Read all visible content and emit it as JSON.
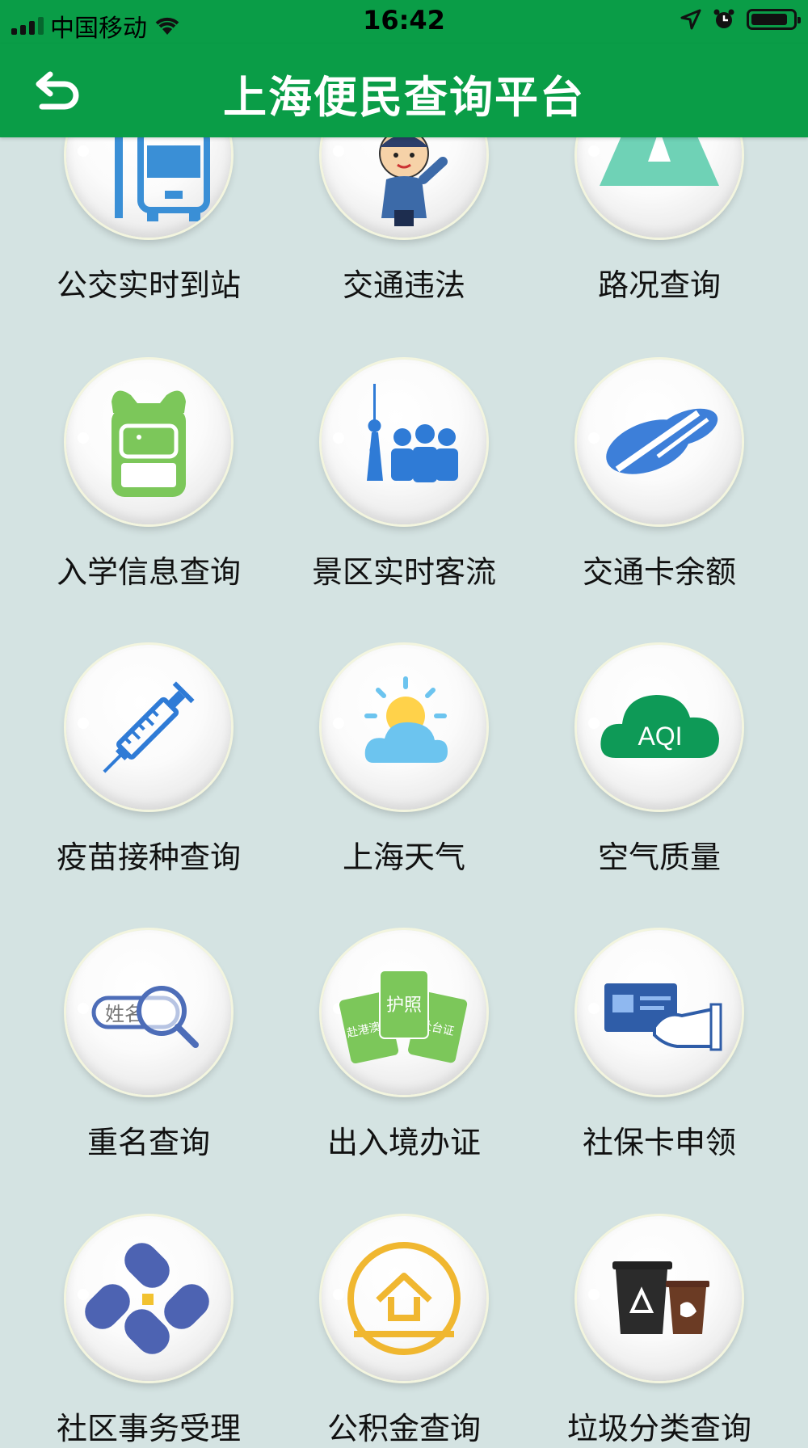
{
  "status_bar": {
    "carrier": "中国移动",
    "time": "16:42"
  },
  "header": {
    "title": "上海便民查询平台"
  },
  "services": [
    {
      "label": "公交实时到站",
      "icon": "bus-icon"
    },
    {
      "label": "交通违法",
      "icon": "traffic-police-icon"
    },
    {
      "label": "路况查询",
      "icon": "road-icon"
    },
    {
      "label": "入学信息查询",
      "icon": "backpack-icon"
    },
    {
      "label": "景区实时客流",
      "icon": "tourist-crowd-icon"
    },
    {
      "label": "交通卡余额",
      "icon": "transit-card-icon"
    },
    {
      "label": "疫苗接种查询",
      "icon": "syringe-icon"
    },
    {
      "label": "上海天气",
      "icon": "weather-icon"
    },
    {
      "label": "空气质量",
      "icon": "aqi-cloud-icon",
      "icon_text": "AQI"
    },
    {
      "label": "重名查询",
      "icon": "name-search-icon",
      "icon_text": "姓名"
    },
    {
      "label": "出入境办证",
      "icon": "passport-icon",
      "icon_texts": [
        "赴港澳证",
        "护照",
        "赴台证"
      ]
    },
    {
      "label": "社保卡申领",
      "icon": "social-security-card-icon"
    },
    {
      "label": "社区事务受理",
      "icon": "community-affairs-icon"
    },
    {
      "label": "公积金查询",
      "icon": "housing-fund-icon"
    },
    {
      "label": "垃圾分类查询",
      "icon": "trash-sorting-icon"
    }
  ],
  "colors": {
    "brand_green": "#0a9d47",
    "background": "#d4e3e2"
  }
}
